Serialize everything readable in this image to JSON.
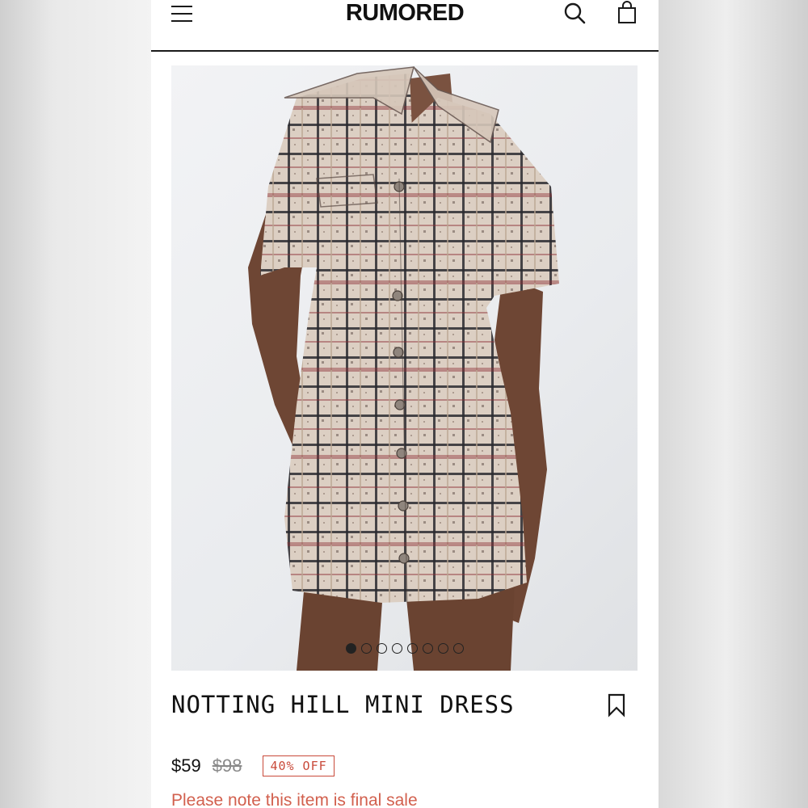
{
  "header": {
    "brand": "RUMORED",
    "icons": [
      "menu-icon",
      "search-icon",
      "bag-icon"
    ]
  },
  "gallery": {
    "total_images": 8,
    "active_index": 0
  },
  "product": {
    "title": "NOTTING HILL MINI DRESS",
    "price": "$59",
    "original_price": "$98",
    "discount_label": "40% OFF",
    "notice": "Please note this item is final sale"
  },
  "colors": {
    "notice": "#d2604e",
    "discount": "#c94a3a",
    "text": "#111111"
  }
}
